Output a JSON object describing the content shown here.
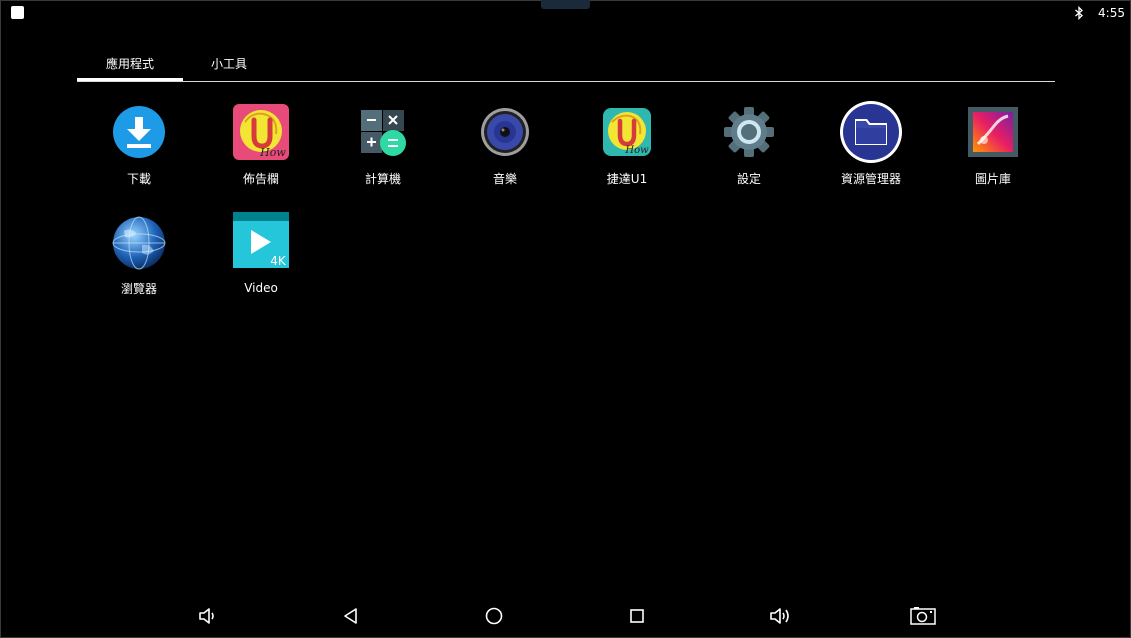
{
  "status_bar": {
    "time": "4:55",
    "icons": [
      "notification-icon",
      "bluetooth-icon"
    ]
  },
  "tabs": [
    {
      "label": "應用程式",
      "active": true
    },
    {
      "label": "小工具",
      "active": false
    }
  ],
  "apps": [
    {
      "label": "下載",
      "icon": "download-icon"
    },
    {
      "label": "佈告欄",
      "icon": "uhow-bulletin-icon"
    },
    {
      "label": "計算機",
      "icon": "calculator-icon"
    },
    {
      "label": "音樂",
      "icon": "music-speaker-icon"
    },
    {
      "label": "捷達U1",
      "icon": "uhow-app-icon"
    },
    {
      "label": "設定",
      "icon": "settings-gear-icon"
    },
    {
      "label": "資源管理器",
      "icon": "file-manager-folder-icon"
    },
    {
      "label": "圖片庫",
      "icon": "gallery-icon"
    },
    {
      "label": "瀏覽器",
      "icon": "browser-globe-icon"
    },
    {
      "label": "Video",
      "icon": "video-4k-icon"
    }
  ],
  "nav_bar": {
    "buttons": [
      "volume-down-icon",
      "back-icon",
      "home-icon",
      "recents-icon",
      "volume-up-icon",
      "screenshot-camera-icon"
    ]
  },
  "colors": {
    "background": "#000000",
    "download_blue": "#1e9be6",
    "uhow_pink": "#e84a7a",
    "uhow_yellow": "#f3e533",
    "calculator_green": "#2fd9a4",
    "folder_navy": "#283593",
    "video_teal": "#26c6da"
  }
}
